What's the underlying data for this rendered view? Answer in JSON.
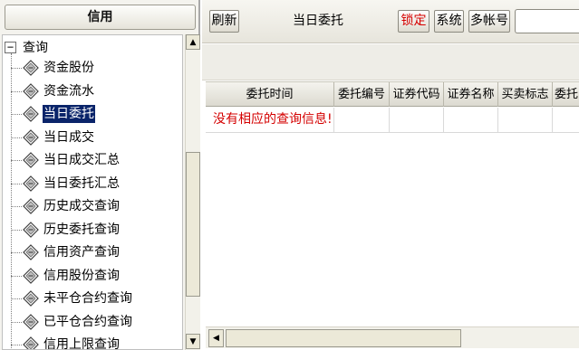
{
  "left_panel": {
    "title": "信用",
    "tree": {
      "root_label": "查询",
      "root_expander": "−",
      "items": [
        {
          "label": "资金股份",
          "selected": false
        },
        {
          "label": "资金流水",
          "selected": false
        },
        {
          "label": "当日委托",
          "selected": true
        },
        {
          "label": "当日成交",
          "selected": false
        },
        {
          "label": "当日成交汇总",
          "selected": false
        },
        {
          "label": "当日委托汇总",
          "selected": false
        },
        {
          "label": "历史成交查询",
          "selected": false
        },
        {
          "label": "历史委托查询",
          "selected": false
        },
        {
          "label": "信用资产查询",
          "selected": false
        },
        {
          "label": "信用股份查询",
          "selected": false
        },
        {
          "label": "未平仓合约查询",
          "selected": false
        },
        {
          "label": "已平仓合约查询",
          "selected": false
        },
        {
          "label": "信用上限查询",
          "selected": false
        }
      ]
    },
    "icons": {
      "leaf": "document-diamond-icon",
      "scroll_up": "▲",
      "scroll_down": "▼"
    }
  },
  "toolbar": {
    "refresh_label": "刷新",
    "title": "当日委托",
    "lock_label": "锁定",
    "system_label": "系统",
    "multi_account_label": "多帐号"
  },
  "grid": {
    "columns": [
      "委托时间",
      "委托编号",
      "证券代码",
      "证券名称",
      "买卖标志",
      "委托"
    ],
    "empty_message": "没有相应的查询信息!"
  },
  "hscroll": {
    "left_arrow": "◀"
  },
  "colors": {
    "selection": "#0a246a",
    "lock_text": "#d60000",
    "empty_message": "#d40000"
  }
}
